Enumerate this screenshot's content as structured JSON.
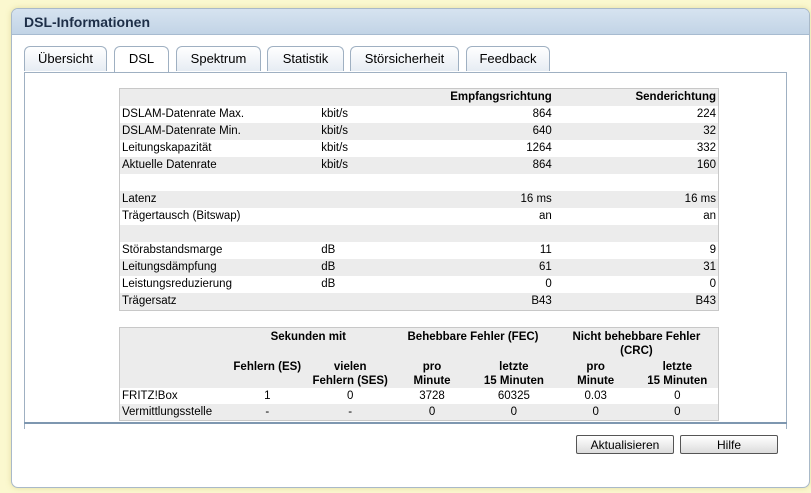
{
  "window": {
    "title": "DSL-Informationen"
  },
  "tabs": [
    {
      "label": "Übersicht"
    },
    {
      "label": "DSL"
    },
    {
      "label": "Spektrum"
    },
    {
      "label": "Statistik"
    },
    {
      "label": "Störsicherheit"
    },
    {
      "label": "Feedback"
    }
  ],
  "info_table": {
    "headers": {
      "downstream": "Empfangsrichtung",
      "upstream": "Senderichtung"
    },
    "rows": [
      {
        "label": "DSLAM-Datenrate Max.",
        "unit": "kbit/s",
        "down": "864",
        "up": "224"
      },
      {
        "label": "DSLAM-Datenrate Min.",
        "unit": "kbit/s",
        "down": "640",
        "up": "32"
      },
      {
        "label": "Leitungskapazität",
        "unit": "kbit/s",
        "down": "1264",
        "up": "332"
      },
      {
        "label": "Aktuelle Datenrate",
        "unit": "kbit/s",
        "down": "864",
        "up": "160"
      },
      {
        "label": "",
        "unit": "",
        "down": "",
        "up": ""
      },
      {
        "label": "Latenz",
        "unit": "",
        "down": "16 ms",
        "up": "16 ms"
      },
      {
        "label": "Trägertausch (Bitswap)",
        "unit": "",
        "down": "an",
        "up": "an"
      },
      {
        "label": "",
        "unit": "",
        "down": "",
        "up": ""
      },
      {
        "label": "Störabstandsmarge",
        "unit": "dB",
        "down": "11",
        "up": "9"
      },
      {
        "label": "Leitungsdämpfung",
        "unit": "dB",
        "down": "61",
        "up": "31"
      },
      {
        "label": "Leistungsreduzierung",
        "unit": "dB",
        "down": "0",
        "up": "0"
      },
      {
        "label": "Trägersatz",
        "unit": "",
        "down": "B43",
        "up": "B43"
      }
    ]
  },
  "error_table": {
    "group_seconds": "Sekunden mit",
    "group_fec": "Behebbare Fehler (FEC)",
    "group_crc_line1": "Nicht behebbare Fehler",
    "group_crc_line2": "(CRC)",
    "sub": {
      "es": "Fehlern (ES)",
      "ses_line1": "vielen",
      "ses_line2": "Fehlern (SES)",
      "fec_min_line1": "pro",
      "fec_min_line2": "Minute",
      "fec_15_line1": "letzte",
      "fec_15_line2": "15 Minuten",
      "crc_min_line1": "pro",
      "crc_min_line2": "Minute",
      "crc_15_line1": "letzte",
      "crc_15_line2": "15 Minuten"
    },
    "rows": [
      {
        "label": "FRITZ!Box",
        "es": "1",
        "ses": "0",
        "fec_min": "3728",
        "fec_15": "60325",
        "crc_min": "0.03",
        "crc_15": "0"
      },
      {
        "label": "Vermittlungsstelle",
        "es": "-",
        "ses": "-",
        "fec_min": "0",
        "fec_15": "0",
        "crc_min": "0",
        "crc_15": "0"
      }
    ]
  },
  "buttons": {
    "refresh": "Aktualisieren",
    "help": "Hilfe"
  }
}
